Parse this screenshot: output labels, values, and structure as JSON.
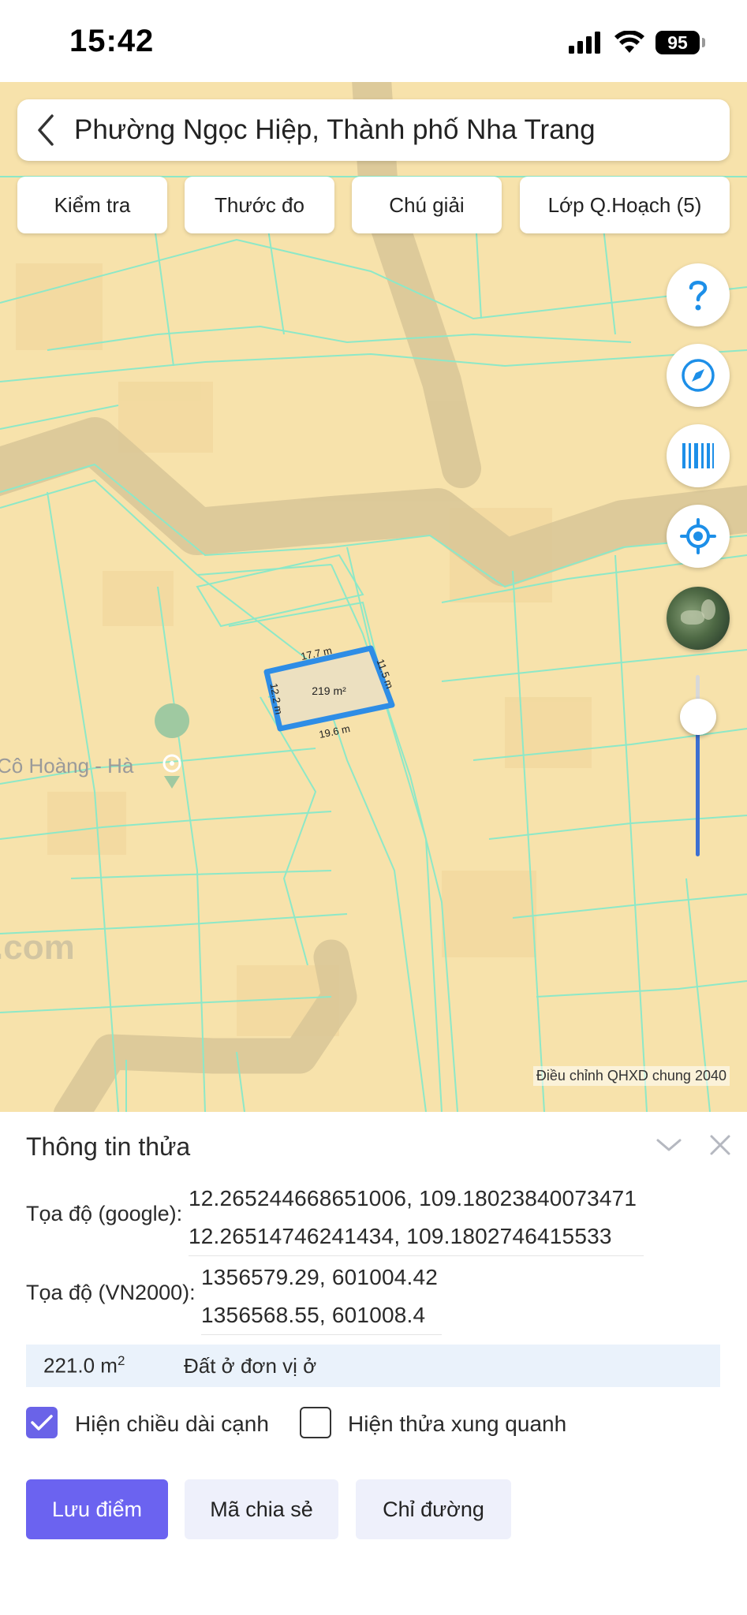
{
  "status_bar": {
    "time": "15:42",
    "battery": "95"
  },
  "map": {
    "location_title": "Phường Ngọc Hiệp, Thành phố Nha Trang",
    "toolbar": {
      "check_label": "Kiểm tra",
      "ruler_label": "Thước đo",
      "legend_label": "Chú giải",
      "layers_label": "Lớp Q.Hoạch (5)"
    },
    "parcel": {
      "area_label": "219 m²",
      "edges": [
        "17.7 m",
        "11.5 m",
        "19.6 m",
        "12.2 m"
      ]
    },
    "poi_label": "Cô Hoàng - Hà",
    "watermark": ".com",
    "attribution": "Điều chỉnh QHXD chung 2040",
    "zoom_level": 0.78,
    "colors": {
      "parcel_outline": "#2e8de6",
      "parcel_fill": "#ece0c0",
      "land": "#f7e2ab",
      "lines": "#8de8c7"
    }
  },
  "panel": {
    "title": "Thông tin thửa",
    "google_label": "Tọa độ (google):",
    "google_coords": [
      "12.265244668651006, 109.18023840073471",
      "12.26514746241434, 109.1802746415533"
    ],
    "vn2000_label": "Tọa độ (VN2000):",
    "vn2000_coords": [
      "1356579.29, 601004.42",
      "1356568.55, 601008.4"
    ],
    "area": "221.0 m",
    "area_sup": "2",
    "land_type": "Đất ở đơn vị ở",
    "show_edge_lengths": {
      "label": "Hiện chiều dài cạnh",
      "checked": true
    },
    "show_neighbors": {
      "label": "Hiện thửa xung quanh",
      "checked": false
    },
    "buttons": {
      "save": "Lưu điểm",
      "share": "Mã chia sẻ",
      "directions": "Chỉ đường"
    }
  }
}
